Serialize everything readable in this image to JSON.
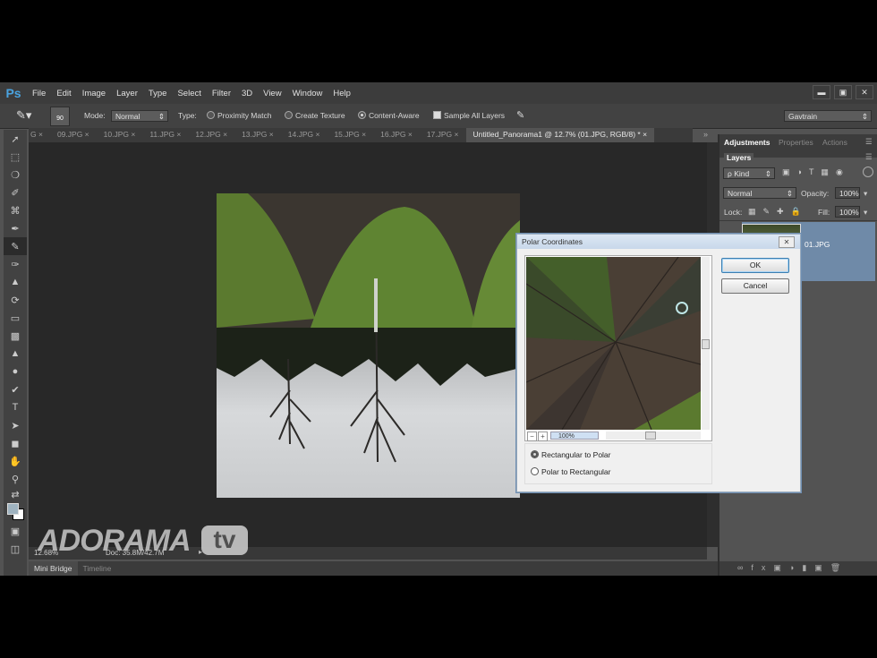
{
  "app": {
    "logo": "Ps"
  },
  "menu": [
    "File",
    "Edit",
    "Image",
    "Layer",
    "Type",
    "Select",
    "Filter",
    "3D",
    "View",
    "Window",
    "Help"
  ],
  "options": {
    "brush_size": "90",
    "mode_label": "Mode:",
    "mode_value": "Normal",
    "type_label": "Type:",
    "types": [
      {
        "label": "Proximity Match",
        "selected": false
      },
      {
        "label": "Create Texture",
        "selected": false
      },
      {
        "label": "Content-Aware",
        "selected": true
      }
    ],
    "sample_all_layers": "Sample All Layers",
    "workspace": "Gavtrain"
  },
  "tabs": [
    {
      "label": "G"
    },
    {
      "label": "09.JPG"
    },
    {
      "label": "10.JPG"
    },
    {
      "label": "11.JPG"
    },
    {
      "label": "12.JPG"
    },
    {
      "label": "13.JPG"
    },
    {
      "label": "14.JPG"
    },
    {
      "label": "15.JPG"
    },
    {
      "label": "16.JPG"
    },
    {
      "label": "17.JPG"
    },
    {
      "label": "Untitled_Panorama1 @ 12.7% (01.JPG, RGB/8) *",
      "active": true
    }
  ],
  "status": {
    "zoom": "12.68%",
    "doc": "Doc: 35.8M/42.7M"
  },
  "bottom_tabs": [
    "Mini Bridge",
    "Timeline"
  ],
  "panel": {
    "tabs": [
      "Adjustments",
      "Properties",
      "Actions"
    ],
    "layers_tab": "Layers",
    "kind": "ρ Kind",
    "blend": "Normal",
    "opacity_label": "Opacity:",
    "opacity": "100%",
    "lock_label": "Lock:",
    "fill_label": "Fill:",
    "fill": "100%",
    "layer_name": "01.JPG"
  },
  "dialog": {
    "title": "Polar Coordinates",
    "ok": "OK",
    "cancel": "Cancel",
    "zoom": "100%",
    "minus": "−",
    "plus": "+",
    "options": [
      {
        "label": "Rectangular to Polar",
        "selected": true
      },
      {
        "label": "Polar to Rectangular",
        "selected": false
      }
    ]
  },
  "watermark": {
    "brand": "ADORAMA",
    "tv": "tv"
  }
}
